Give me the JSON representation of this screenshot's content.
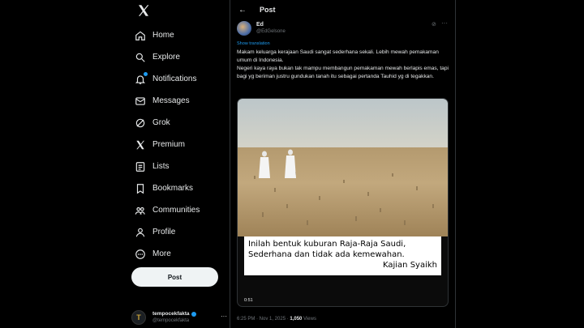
{
  "sidebar": {
    "items": [
      {
        "label": "Home",
        "icon": "home-icon"
      },
      {
        "label": "Explore",
        "icon": "search-icon"
      },
      {
        "label": "Notifications",
        "icon": "bell-icon"
      },
      {
        "label": "Messages",
        "icon": "mail-icon"
      },
      {
        "label": "Grok",
        "icon": "grok-icon"
      },
      {
        "label": "Premium",
        "icon": "x-logo-icon"
      },
      {
        "label": "Lists",
        "icon": "list-icon"
      },
      {
        "label": "Bookmarks",
        "icon": "bookmark-icon"
      },
      {
        "label": "Communities",
        "icon": "people-icon"
      },
      {
        "label": "Profile",
        "icon": "person-icon"
      },
      {
        "label": "More",
        "icon": "more-circle-icon"
      }
    ],
    "post_label": "Post",
    "account": {
      "name": "tempocekfakta",
      "handle": "@tempocekfakta",
      "avatar_letter": "T"
    }
  },
  "header": {
    "title": "Post"
  },
  "tweet": {
    "author_name": "Ed",
    "author_handle": "@EdGelsone",
    "translate_label": "Show translation",
    "text": "Makam keluarga kerajaan Saudi sangat sederhana sekali. Lebih mewah pemakaman umum di Indonesia.\nNegeri kaya raya bukan tak mampu membangun pemakaman mewah berlapis emas, tapi bagi yg beriman justru gundukan tanah itu sebagai pertanda Tauhid yg di tegakkan.",
    "caption": {
      "line1": "Inilah bentuk kuburan Raja-Raja Saudi,",
      "line2": "Sederhana dan tidak ada kemewahan.",
      "line3": "Kajian Syaikh"
    },
    "timer": "0:51",
    "time": "6:25 PM · Nov 1, 2025 · ",
    "views": "1,050",
    "views_label": " Views"
  },
  "colors": {
    "accent": "#1d9bf0",
    "background": "#000000",
    "text": "#e7e9ea",
    "muted": "#71767b"
  }
}
